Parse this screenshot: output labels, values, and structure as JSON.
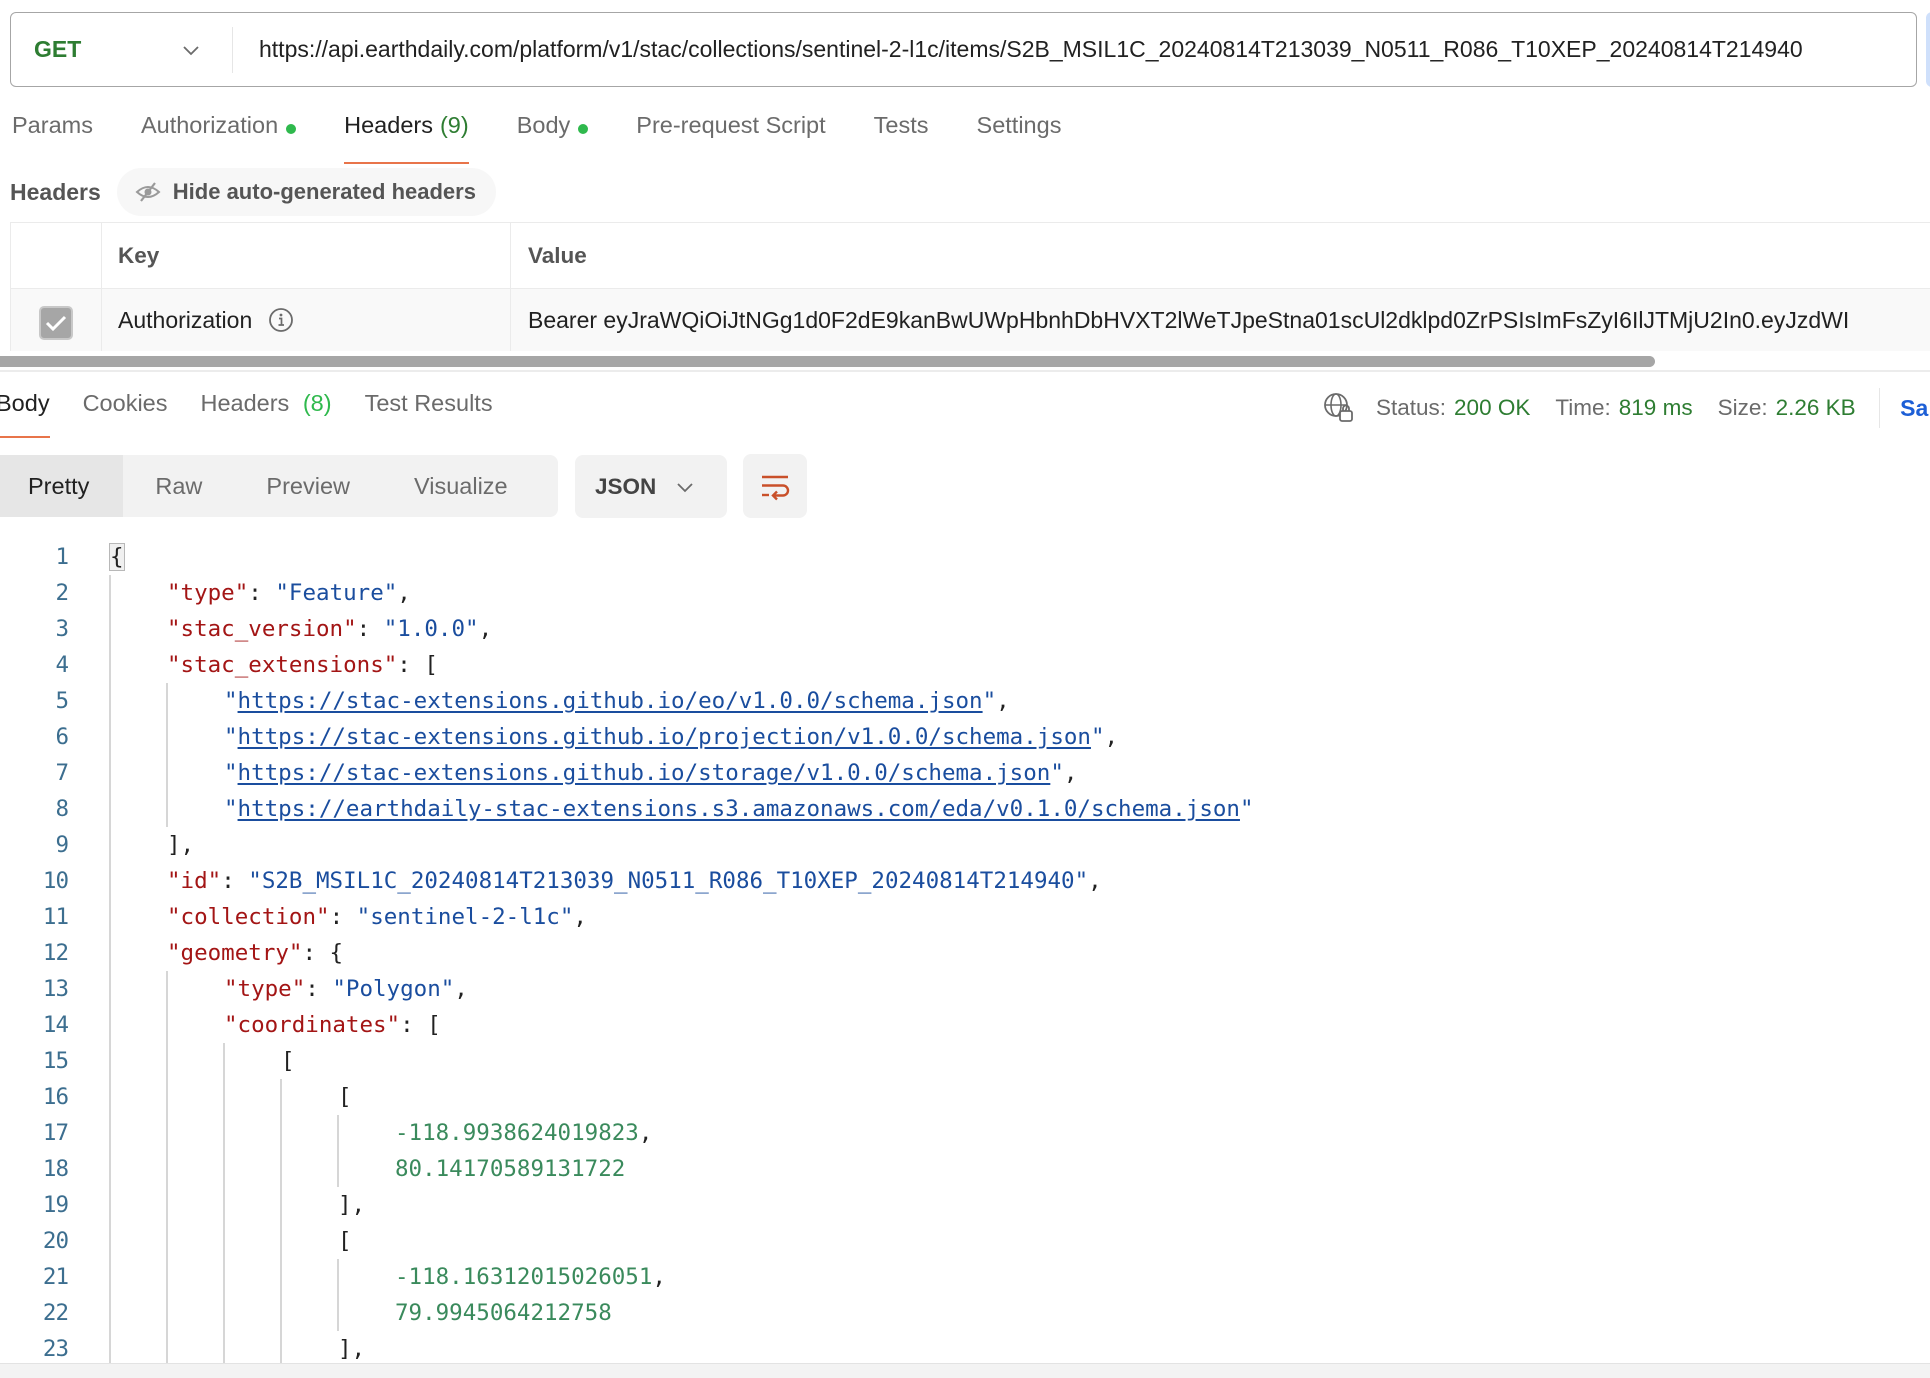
{
  "request": {
    "method": "GET",
    "url": "https://api.earthdaily.com/platform/v1/stac/collections/sentinel-2-l1c/items/S2B_MSIL1C_20240814T213039_N0511_R086_T10XEP_20240814T214940"
  },
  "request_tabs": [
    {
      "label": "Params",
      "count": null,
      "dot": false,
      "active": false
    },
    {
      "label": "Authorization",
      "count": null,
      "dot": true,
      "active": false
    },
    {
      "label": "Headers",
      "count": "(9)",
      "dot": false,
      "active": true
    },
    {
      "label": "Body",
      "count": null,
      "dot": true,
      "active": false
    },
    {
      "label": "Pre-request Script",
      "count": null,
      "dot": false,
      "active": false
    },
    {
      "label": "Tests",
      "count": null,
      "dot": false,
      "active": false
    },
    {
      "label": "Settings",
      "count": null,
      "dot": false,
      "active": false
    }
  ],
  "headers_section": {
    "title": "Headers",
    "hide_button": "Hide auto-generated headers",
    "columns": {
      "key": "Key",
      "value": "Value"
    },
    "rows": [
      {
        "checked": true,
        "key": "Authorization",
        "value": "Bearer eyJraWQiOiJtNGg1d0F2dE9kanBwUWpHbnhDbHVXT2lWeTJpeStna01scUl2dklpd0ZrPSIsImFsZyI6IlJTMjU2In0.eyJzdWI"
      }
    ]
  },
  "response_tabs": [
    {
      "label": "Body",
      "count": null,
      "active": true
    },
    {
      "label": "Cookies",
      "count": null,
      "active": false
    },
    {
      "label": "Headers",
      "count": "(8)",
      "active": false
    },
    {
      "label": "Test Results",
      "count": null,
      "active": false
    }
  ],
  "response_meta": {
    "status_label": "Status:",
    "status_value": "200 OK",
    "time_label": "Time:",
    "time_value": "819 ms",
    "size_label": "Size:",
    "size_value": "2.26 KB",
    "save_label": "Sa"
  },
  "view_modes": [
    {
      "label": "Pretty",
      "active": true
    },
    {
      "label": "Raw",
      "active": false
    },
    {
      "label": "Preview",
      "active": false
    },
    {
      "label": "Visualize",
      "active": false
    }
  ],
  "format": "JSON",
  "colors": {
    "accent_tab_underline": "#e8744a",
    "status_green": "#2e7d32",
    "count_green": "#2fb94d",
    "json_key": "#a31515",
    "json_string": "#1a4d9e",
    "json_number": "#3a8a5c",
    "link_blue": "#1d5fd6"
  },
  "code_lines": [
    {
      "n": "1",
      "indent": 0,
      "parts": [
        {
          "t": "{",
          "c": "p brace-hl"
        }
      ]
    },
    {
      "n": "2",
      "indent": 1,
      "parts": [
        {
          "t": "\"type\"",
          "c": "k"
        },
        {
          "t": ": ",
          "c": "p"
        },
        {
          "t": "\"Feature\"",
          "c": "s"
        },
        {
          "t": ",",
          "c": "p"
        }
      ]
    },
    {
      "n": "3",
      "indent": 1,
      "parts": [
        {
          "t": "\"stac_version\"",
          "c": "k"
        },
        {
          "t": ": ",
          "c": "p"
        },
        {
          "t": "\"1.0.0\"",
          "c": "s"
        },
        {
          "t": ",",
          "c": "p"
        }
      ]
    },
    {
      "n": "4",
      "indent": 1,
      "parts": [
        {
          "t": "\"stac_extensions\"",
          "c": "k"
        },
        {
          "t": ": [",
          "c": "p"
        }
      ]
    },
    {
      "n": "5",
      "indent": 2,
      "parts": [
        {
          "t": "\"",
          "c": "s"
        },
        {
          "t": "https://stac-extensions.github.io/eo/v1.0.0/schema.json",
          "c": "u"
        },
        {
          "t": "\"",
          "c": "s"
        },
        {
          "t": ",",
          "c": "p"
        }
      ]
    },
    {
      "n": "6",
      "indent": 2,
      "parts": [
        {
          "t": "\"",
          "c": "s"
        },
        {
          "t": "https://stac-extensions.github.io/projection/v1.0.0/schema.json",
          "c": "u"
        },
        {
          "t": "\"",
          "c": "s"
        },
        {
          "t": ",",
          "c": "p"
        }
      ]
    },
    {
      "n": "7",
      "indent": 2,
      "parts": [
        {
          "t": "\"",
          "c": "s"
        },
        {
          "t": "https://stac-extensions.github.io/storage/v1.0.0/schema.json",
          "c": "u"
        },
        {
          "t": "\"",
          "c": "s"
        },
        {
          "t": ",",
          "c": "p"
        }
      ]
    },
    {
      "n": "8",
      "indent": 2,
      "parts": [
        {
          "t": "\"",
          "c": "s"
        },
        {
          "t": "https://earthdaily-stac-extensions.s3.amazonaws.com/eda/v0.1.0/schema.json",
          "c": "u"
        },
        {
          "t": "\"",
          "c": "s"
        }
      ]
    },
    {
      "n": "9",
      "indent": 1,
      "parts": [
        {
          "t": "],",
          "c": "p"
        }
      ]
    },
    {
      "n": "10",
      "indent": 1,
      "parts": [
        {
          "t": "\"id\"",
          "c": "k"
        },
        {
          "t": ": ",
          "c": "p"
        },
        {
          "t": "\"S2B_MSIL1C_20240814T213039_N0511_R086_T10XEP_20240814T214940\"",
          "c": "s"
        },
        {
          "t": ",",
          "c": "p"
        }
      ]
    },
    {
      "n": "11",
      "indent": 1,
      "parts": [
        {
          "t": "\"collection\"",
          "c": "k"
        },
        {
          "t": ": ",
          "c": "p"
        },
        {
          "t": "\"sentinel-2-l1c\"",
          "c": "s"
        },
        {
          "t": ",",
          "c": "p"
        }
      ]
    },
    {
      "n": "12",
      "indent": 1,
      "parts": [
        {
          "t": "\"geometry\"",
          "c": "k"
        },
        {
          "t": ": {",
          "c": "p"
        }
      ]
    },
    {
      "n": "13",
      "indent": 2,
      "parts": [
        {
          "t": "\"type\"",
          "c": "k"
        },
        {
          "t": ": ",
          "c": "p"
        },
        {
          "t": "\"Polygon\"",
          "c": "s"
        },
        {
          "t": ",",
          "c": "p"
        }
      ]
    },
    {
      "n": "14",
      "indent": 2,
      "parts": [
        {
          "t": "\"coordinates\"",
          "c": "k"
        },
        {
          "t": ": [",
          "c": "p"
        }
      ]
    },
    {
      "n": "15",
      "indent": 3,
      "parts": [
        {
          "t": "[",
          "c": "p"
        }
      ]
    },
    {
      "n": "16",
      "indent": 4,
      "parts": [
        {
          "t": "[",
          "c": "p"
        }
      ]
    },
    {
      "n": "17",
      "indent": 5,
      "parts": [
        {
          "t": "-118.9938624019823",
          "c": "n"
        },
        {
          "t": ",",
          "c": "p"
        }
      ]
    },
    {
      "n": "18",
      "indent": 5,
      "parts": [
        {
          "t": "80.14170589131722",
          "c": "n"
        }
      ]
    },
    {
      "n": "19",
      "indent": 4,
      "parts": [
        {
          "t": "],",
          "c": "p"
        }
      ]
    },
    {
      "n": "20",
      "indent": 4,
      "parts": [
        {
          "t": "[",
          "c": "p"
        }
      ]
    },
    {
      "n": "21",
      "indent": 5,
      "parts": [
        {
          "t": "-118.16312015026051",
          "c": "n"
        },
        {
          "t": ",",
          "c": "p"
        }
      ]
    },
    {
      "n": "22",
      "indent": 5,
      "parts": [
        {
          "t": "79.9945064212758",
          "c": "n"
        }
      ]
    },
    {
      "n": "23",
      "indent": 4,
      "parts": [
        {
          "t": "],",
          "c": "p"
        }
      ]
    }
  ]
}
